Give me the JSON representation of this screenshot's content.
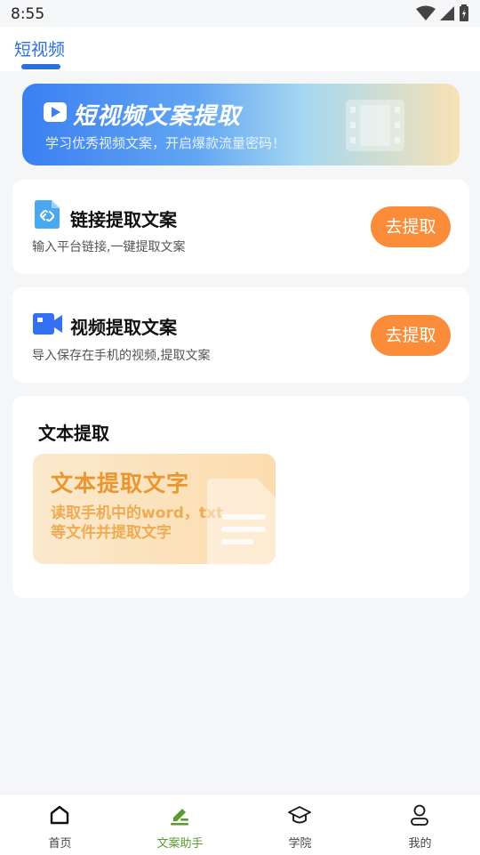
{
  "status_bar": {
    "time": "8:55"
  },
  "top_tabs": [
    {
      "label": "短视频",
      "active": true
    }
  ],
  "banner": {
    "title": "短视频文案提取",
    "subtitle": "学习优秀视频文案，开启爆款流量密码！"
  },
  "cards": {
    "link_extract": {
      "title": "链接提取文案",
      "description": "输入平台链接,一键提取文案",
      "button": "去提取"
    },
    "video_extract": {
      "title": "视频提取文案",
      "description": "导入保存在手机的视频,提取文案",
      "button": "去提取"
    },
    "text_extract": {
      "title": "文本提取",
      "tile_title": "文本提取文字",
      "tile_description": "读取手机中的word，txt等文件并提取文字"
    }
  },
  "bottom_nav": [
    {
      "label": "首页",
      "icon": "home-icon",
      "active": false
    },
    {
      "label": "文案助手",
      "icon": "edit-icon",
      "active": true
    },
    {
      "label": "学院",
      "icon": "graduation-cap-icon",
      "active": false
    },
    {
      "label": "我的",
      "icon": "user-icon",
      "active": false
    }
  ],
  "colors": {
    "accent_blue": "#2b6fe0",
    "button_orange": "#fb8c3a",
    "nav_active_green": "#5a9a2e"
  }
}
